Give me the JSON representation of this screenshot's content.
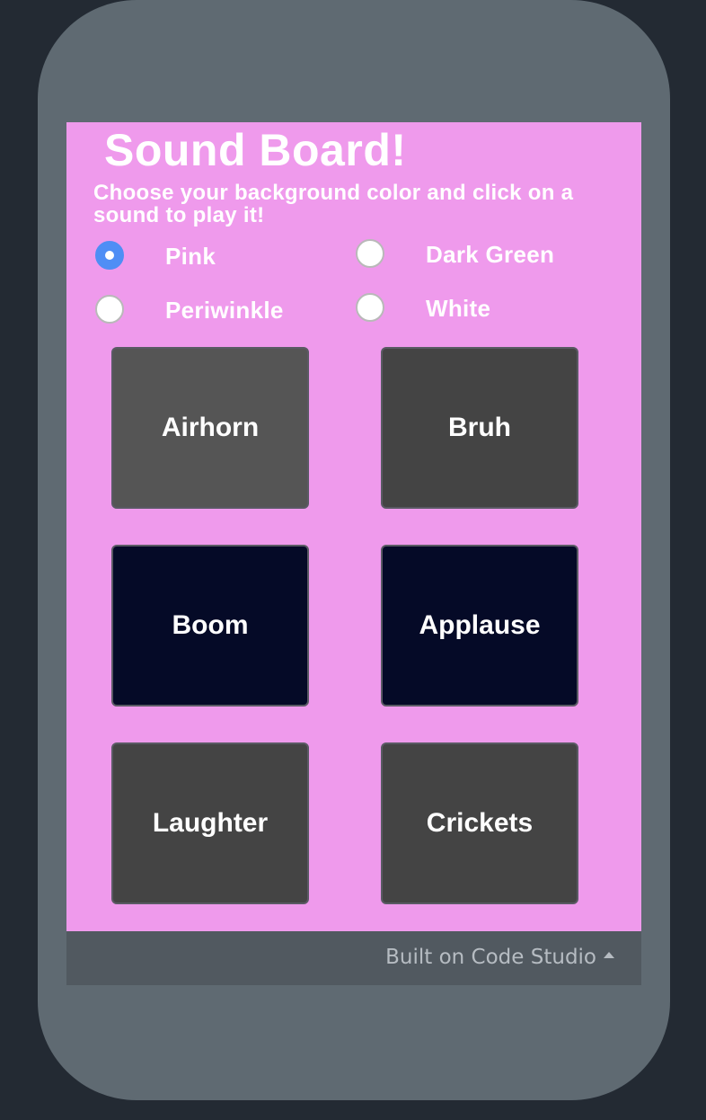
{
  "app": {
    "title": "Sound Board!",
    "subtitle": "Choose your background color and click on a sound to play it!"
  },
  "background_options": [
    {
      "label": "Pink",
      "checked": true
    },
    {
      "label": "Dark Green",
      "checked": false
    },
    {
      "label": "Periwinkle",
      "checked": false
    },
    {
      "label": "White",
      "checked": false
    }
  ],
  "sounds": [
    {
      "label": "Airhorn",
      "color": "#555555"
    },
    {
      "label": "Bruh",
      "color": "#444444"
    },
    {
      "label": "Boom",
      "color": "#050a27"
    },
    {
      "label": "Applause",
      "color": "#050a27"
    },
    {
      "label": "Laughter",
      "color": "#444444"
    },
    {
      "label": "Crickets",
      "color": "#444444"
    }
  ],
  "footer": {
    "label": "Built on Code Studio",
    "icon": "caret-up-icon"
  },
  "colors": {
    "screen_background": "#ef9aec",
    "radio_selected": "#4f8ef5",
    "device_frame": "#5f6a72",
    "page_background": "#232a33",
    "footer_background": "#515960"
  }
}
